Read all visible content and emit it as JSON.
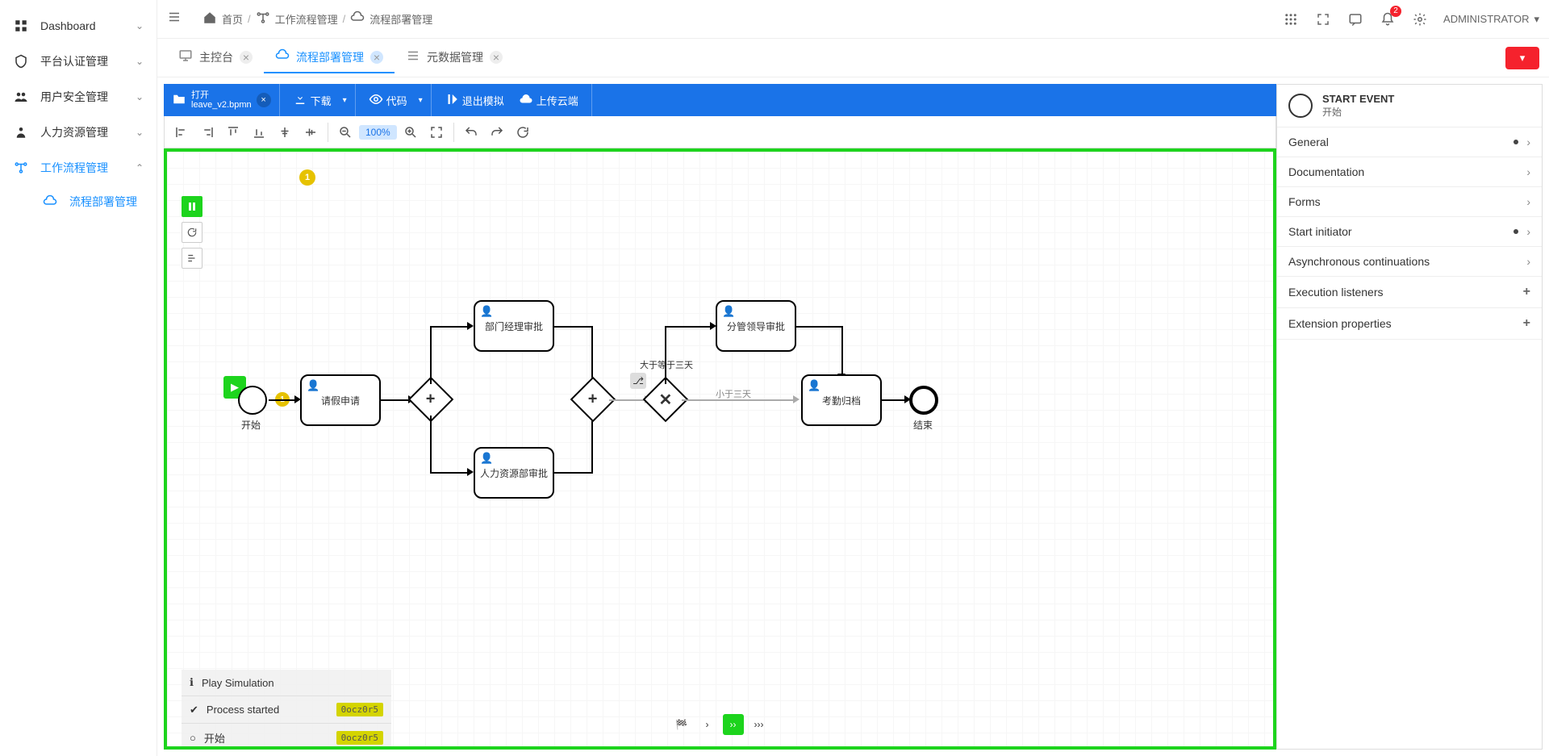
{
  "sidebar": {
    "items": [
      {
        "label": "Dashboard",
        "expanded": false
      },
      {
        "label": "平台认证管理",
        "expanded": false
      },
      {
        "label": "用户安全管理",
        "expanded": false
      },
      {
        "label": "人力资源管理",
        "expanded": false
      },
      {
        "label": "工作流程管理",
        "expanded": true,
        "active": true
      }
    ],
    "sub": {
      "label": "流程部署管理"
    }
  },
  "breadcrumb": {
    "home": "首页",
    "mid": "工作流程管理",
    "last": "流程部署管理"
  },
  "topright": {
    "badge": "2",
    "user": "ADMINISTRATOR"
  },
  "tabs": [
    {
      "label": "主控台",
      "active": false
    },
    {
      "label": "流程部署管理",
      "active": true
    },
    {
      "label": "元数据管理",
      "active": false
    }
  ],
  "toolbar": {
    "open": "打开",
    "filename": "leave_v2.bpmn",
    "download": "下载",
    "code": "代码",
    "exit_sim": "退出模拟",
    "upload": "上传云端",
    "zoom": "100%"
  },
  "canvas": {
    "token_top": "1",
    "token_start": "1",
    "start_label": "开始",
    "end_label": "结束",
    "task1": "请假申请",
    "task2": "部门经理审批",
    "task3": "人力资源部审批",
    "task4": "分管领导审批",
    "task5": "考勤归档",
    "cond1": "大于等于三天",
    "cond2": "小于三天"
  },
  "simlog": {
    "title": "Play Simulation",
    "r1": "Process started",
    "r1id": "0ocz0r5",
    "r2": "开始",
    "r2id": "0ocz0r5"
  },
  "props": {
    "title": "START EVENT",
    "sub": "开始",
    "rows": [
      {
        "label": "General",
        "dot": true,
        "chev": true
      },
      {
        "label": "Documentation",
        "chev": true
      },
      {
        "label": "Forms",
        "chev": true
      },
      {
        "label": "Start initiator",
        "dot": true,
        "chev": true
      },
      {
        "label": "Asynchronous continuations",
        "chev": true
      },
      {
        "label": "Execution listeners",
        "plus": true
      },
      {
        "label": "Extension properties",
        "plus": true
      }
    ]
  }
}
